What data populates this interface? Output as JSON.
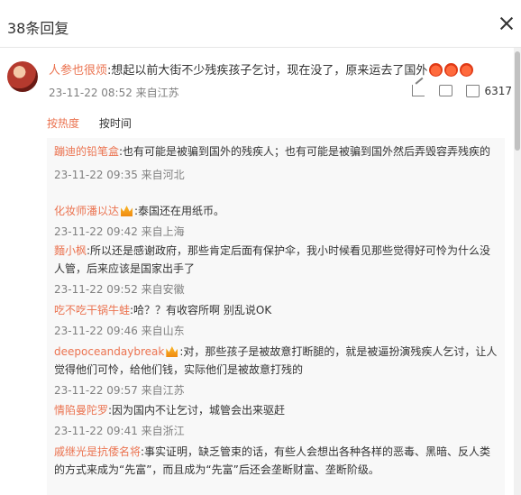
{
  "header": {
    "title": "38条回复"
  },
  "main_comment": {
    "username": "人参也很烦",
    "text": ":想起以前大街不少残疾孩子乞讨，现在没了，原来运去了国外",
    "meta": "23-11-22 08:52 来自江苏",
    "likes": "6317"
  },
  "sort": {
    "by_hot": "按热度",
    "by_time": "按时间"
  },
  "replies": [
    {
      "username": "蹦迪的铅笔盒",
      "text": ":也有可能是被骗到国外的残疾人；也有可能是被骗到国外然后弄毁容弄残疾的",
      "meta": "23-11-22 09:35 来自河北"
    },
    {
      "username": "化妆师潘以达",
      "text": ":泰国还在用纸币。",
      "meta": "23-11-22 09:42 来自上海"
    },
    {
      "username": "麵小枫",
      "text": ":所以还是感谢政府，那些肯定后面有保护伞，我小时候看见那些觉得好可怜为什么没人管，后来应该是国家出手了",
      "meta": "23-11-22 09:52 来自安徽"
    },
    {
      "username": "吃不吃干锅牛蛙",
      "text": ":哈？？有收容所啊 别乱说OK",
      "meta": "23-11-22 09:46 来自山东"
    },
    {
      "username": "deepoceandaybreak",
      "text": ":对，那些孩子是被故意打断腿的，就是被逼扮演残疾人乞讨，让人觉得他们可怜，给他们钱，实际他们是被故意打残的",
      "meta": "23-11-22 09:57 来自江苏"
    },
    {
      "username": "情陷曼陀罗",
      "text": ":因为国内不让乞讨，城管会出来驱赶",
      "meta": "23-11-22 09:41 来自浙江"
    },
    {
      "username": "戚继光是抗倭名将",
      "text": ":事实证明，缺乏管束的话，有些人会想出各种各样的恶毒、黑暗、反人类的方式来成为“先富”，而且成为“先富”后还会垄断财富、垄断阶级。",
      "meta": ""
    }
  ]
}
